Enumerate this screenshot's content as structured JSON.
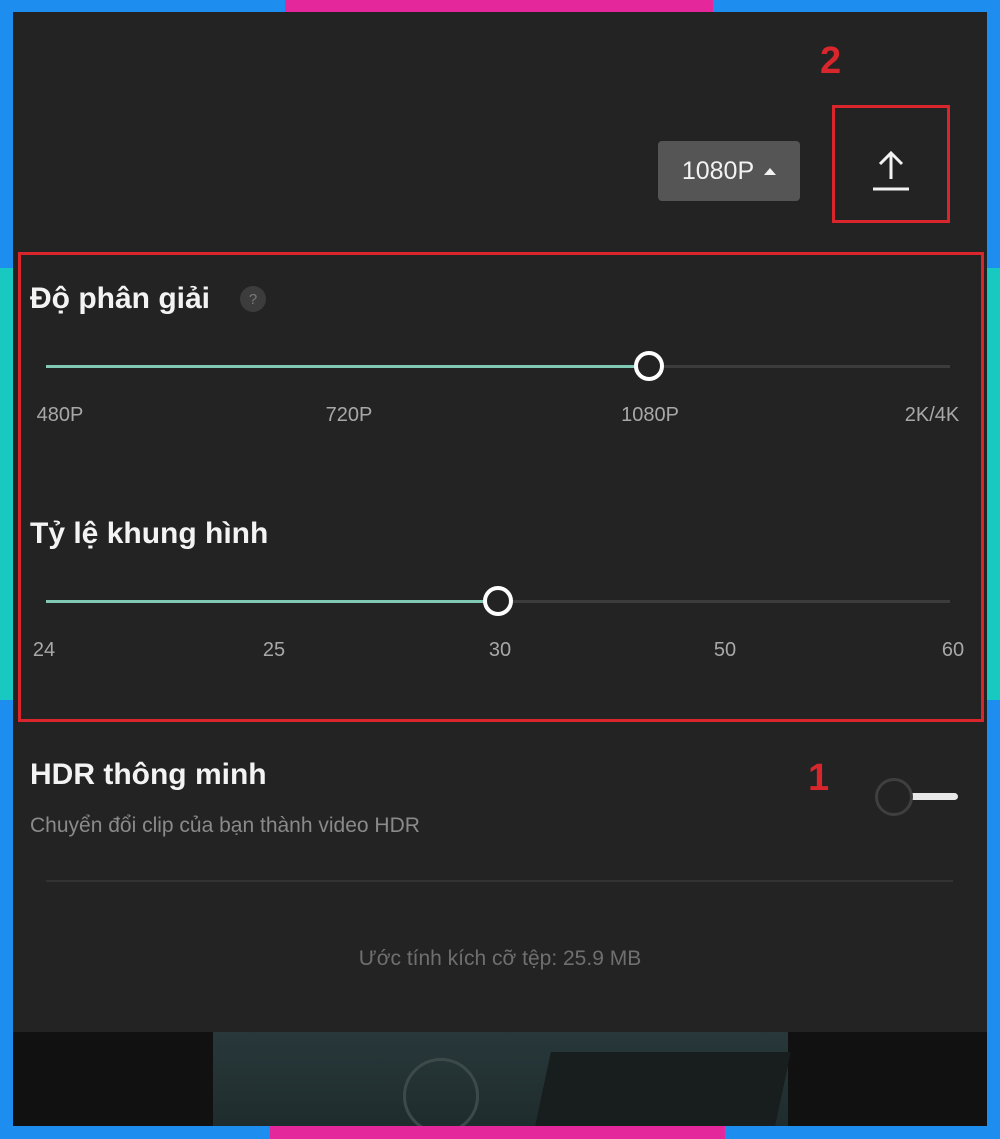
{
  "annotations": {
    "label_1": "1",
    "label_2": "2",
    "color": "#d8262c"
  },
  "header": {
    "resolution_button_label": "1080P",
    "export_icon": "upload-icon"
  },
  "resolution": {
    "title": "Độ phân giải",
    "help_icon_glyph": "?",
    "ticks": [
      "480P",
      "720P",
      "1080P",
      "2K/4K"
    ],
    "selected": "1080P",
    "selected_index": 2
  },
  "frame_rate": {
    "title": "Tỷ lệ khung hình",
    "ticks": [
      "24",
      "25",
      "30",
      "50",
      "60"
    ],
    "selected": "30",
    "selected_index": 2
  },
  "hdr": {
    "title": "HDR thông minh",
    "subtitle": "Chuyển đổi clip của bạn thành video HDR",
    "enabled": false
  },
  "footer": {
    "file_size_text": "Ước tính kích cỡ tệp: 25.9 MB"
  },
  "colors": {
    "background": "#232323",
    "slider_fill": "#7fc9b5",
    "slider_track": "#3c3c3c",
    "outer_frame": "#1d8df0"
  }
}
